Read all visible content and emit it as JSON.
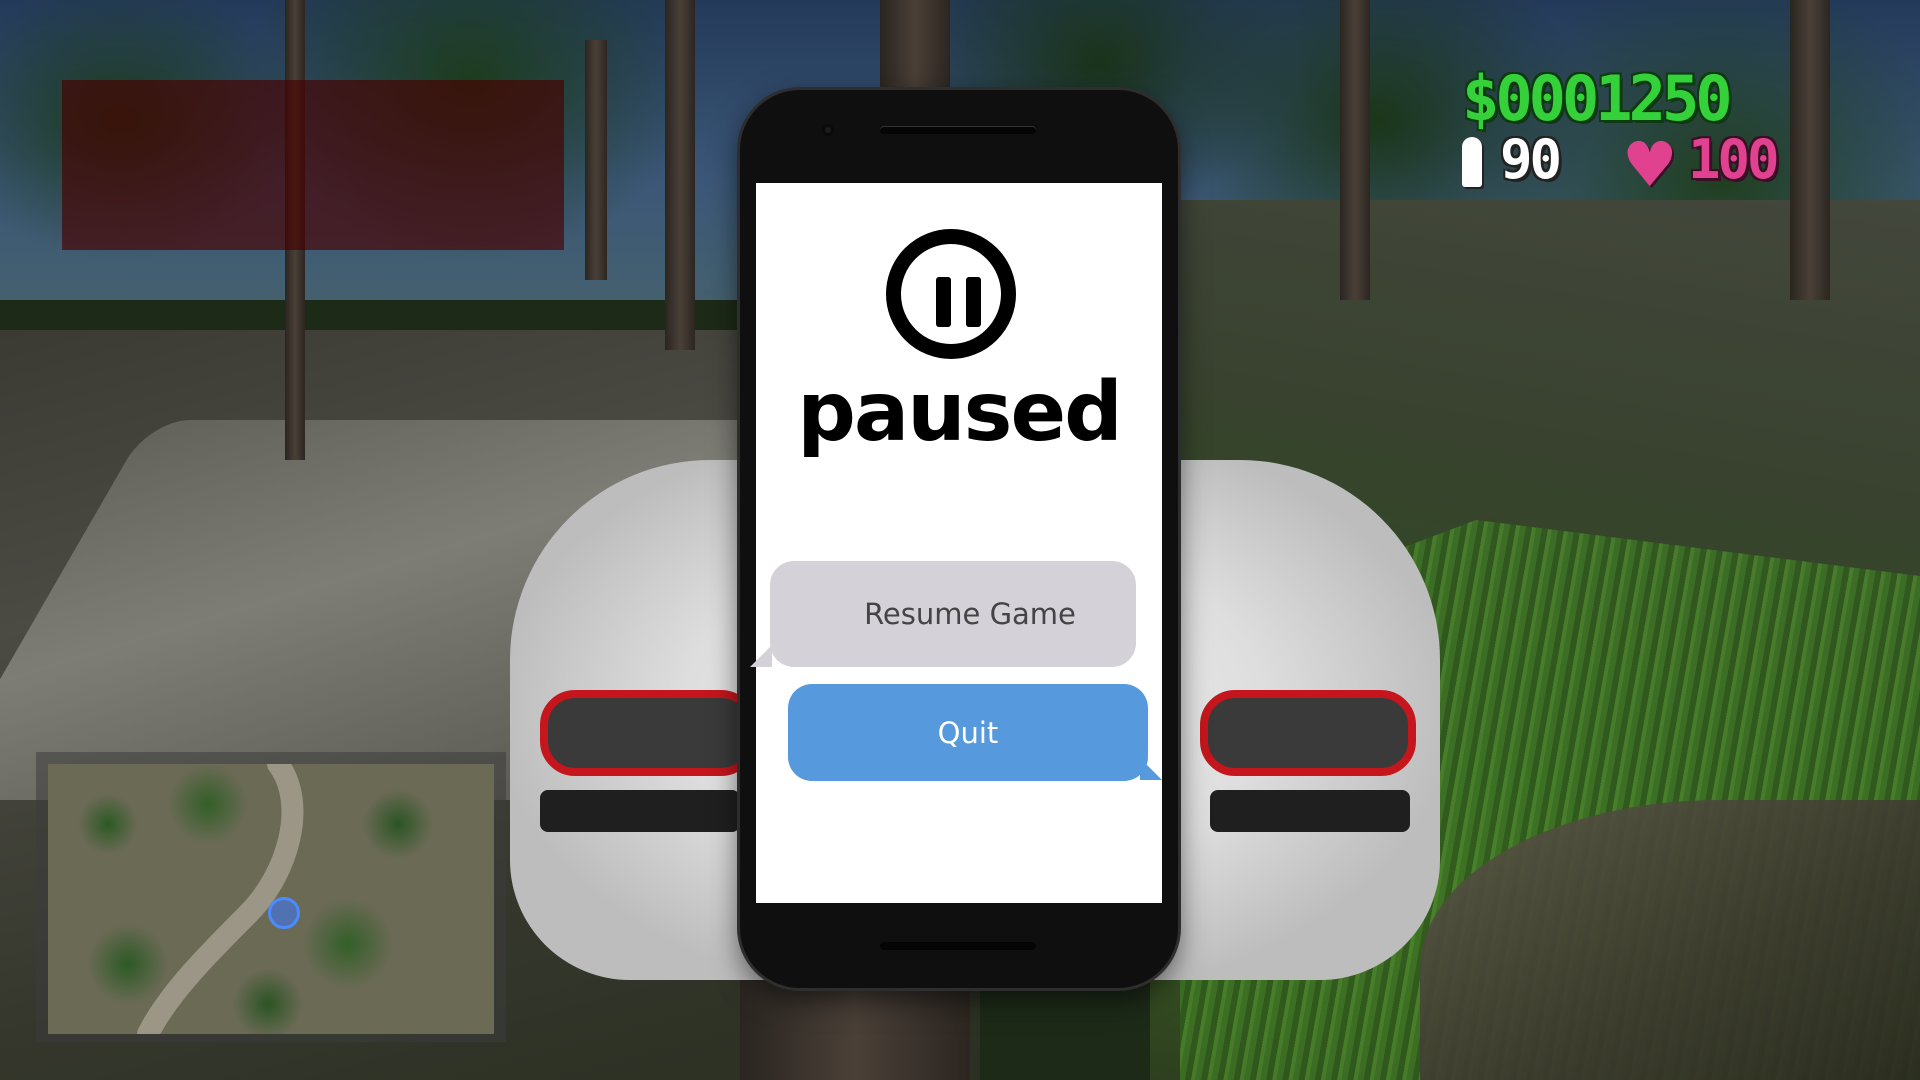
{
  "hud": {
    "money": "$0001250",
    "ammo": "90",
    "health": "100",
    "icons": {
      "ammo": "bullet-icon",
      "health": "heart-icon"
    },
    "colors": {
      "money": "#35d13a",
      "ammo": "#ffffff",
      "health": "#e0428f",
      "quit_button": "#5699dc",
      "resume_button": "#d4d2d8"
    }
  },
  "pause_menu": {
    "title": "paused",
    "icon": "pause-icon",
    "resume_label": "Resume Game",
    "quit_label": "Quit"
  }
}
